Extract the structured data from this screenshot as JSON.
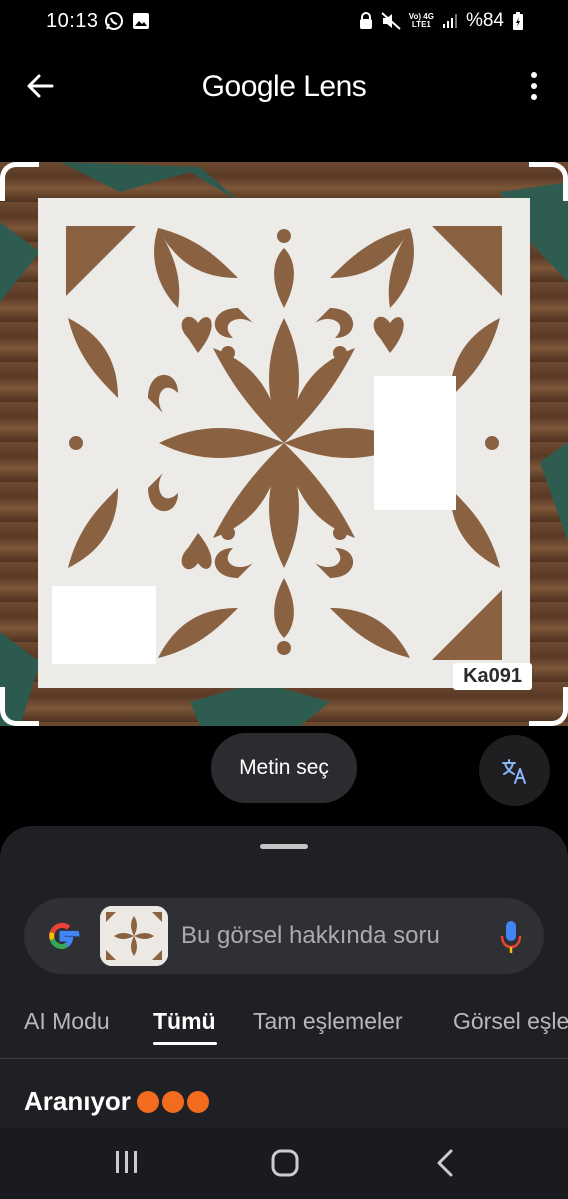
{
  "status": {
    "time": "10:13",
    "net_top": "Vo) 4G",
    "net_bottom": "LTE1",
    "battery": "%84"
  },
  "top_bar": {
    "title": "Google Lens"
  },
  "image": {
    "label": "Ka091"
  },
  "actions": {
    "select_text": "Metin seç"
  },
  "sheet": {
    "search_placeholder": "Bu görsel hakkında soru",
    "tabs": [
      "AI Modu",
      "Tümü",
      "Tam eşlemeler",
      "Görsel eşle"
    ],
    "active_tab": "Tümü",
    "searching_text": "Aranıyor"
  },
  "colors": {
    "background": "#000000",
    "sheet": "#1f2024",
    "search_bar": "#2e3034",
    "accent_blue": "#8ab4f8"
  }
}
